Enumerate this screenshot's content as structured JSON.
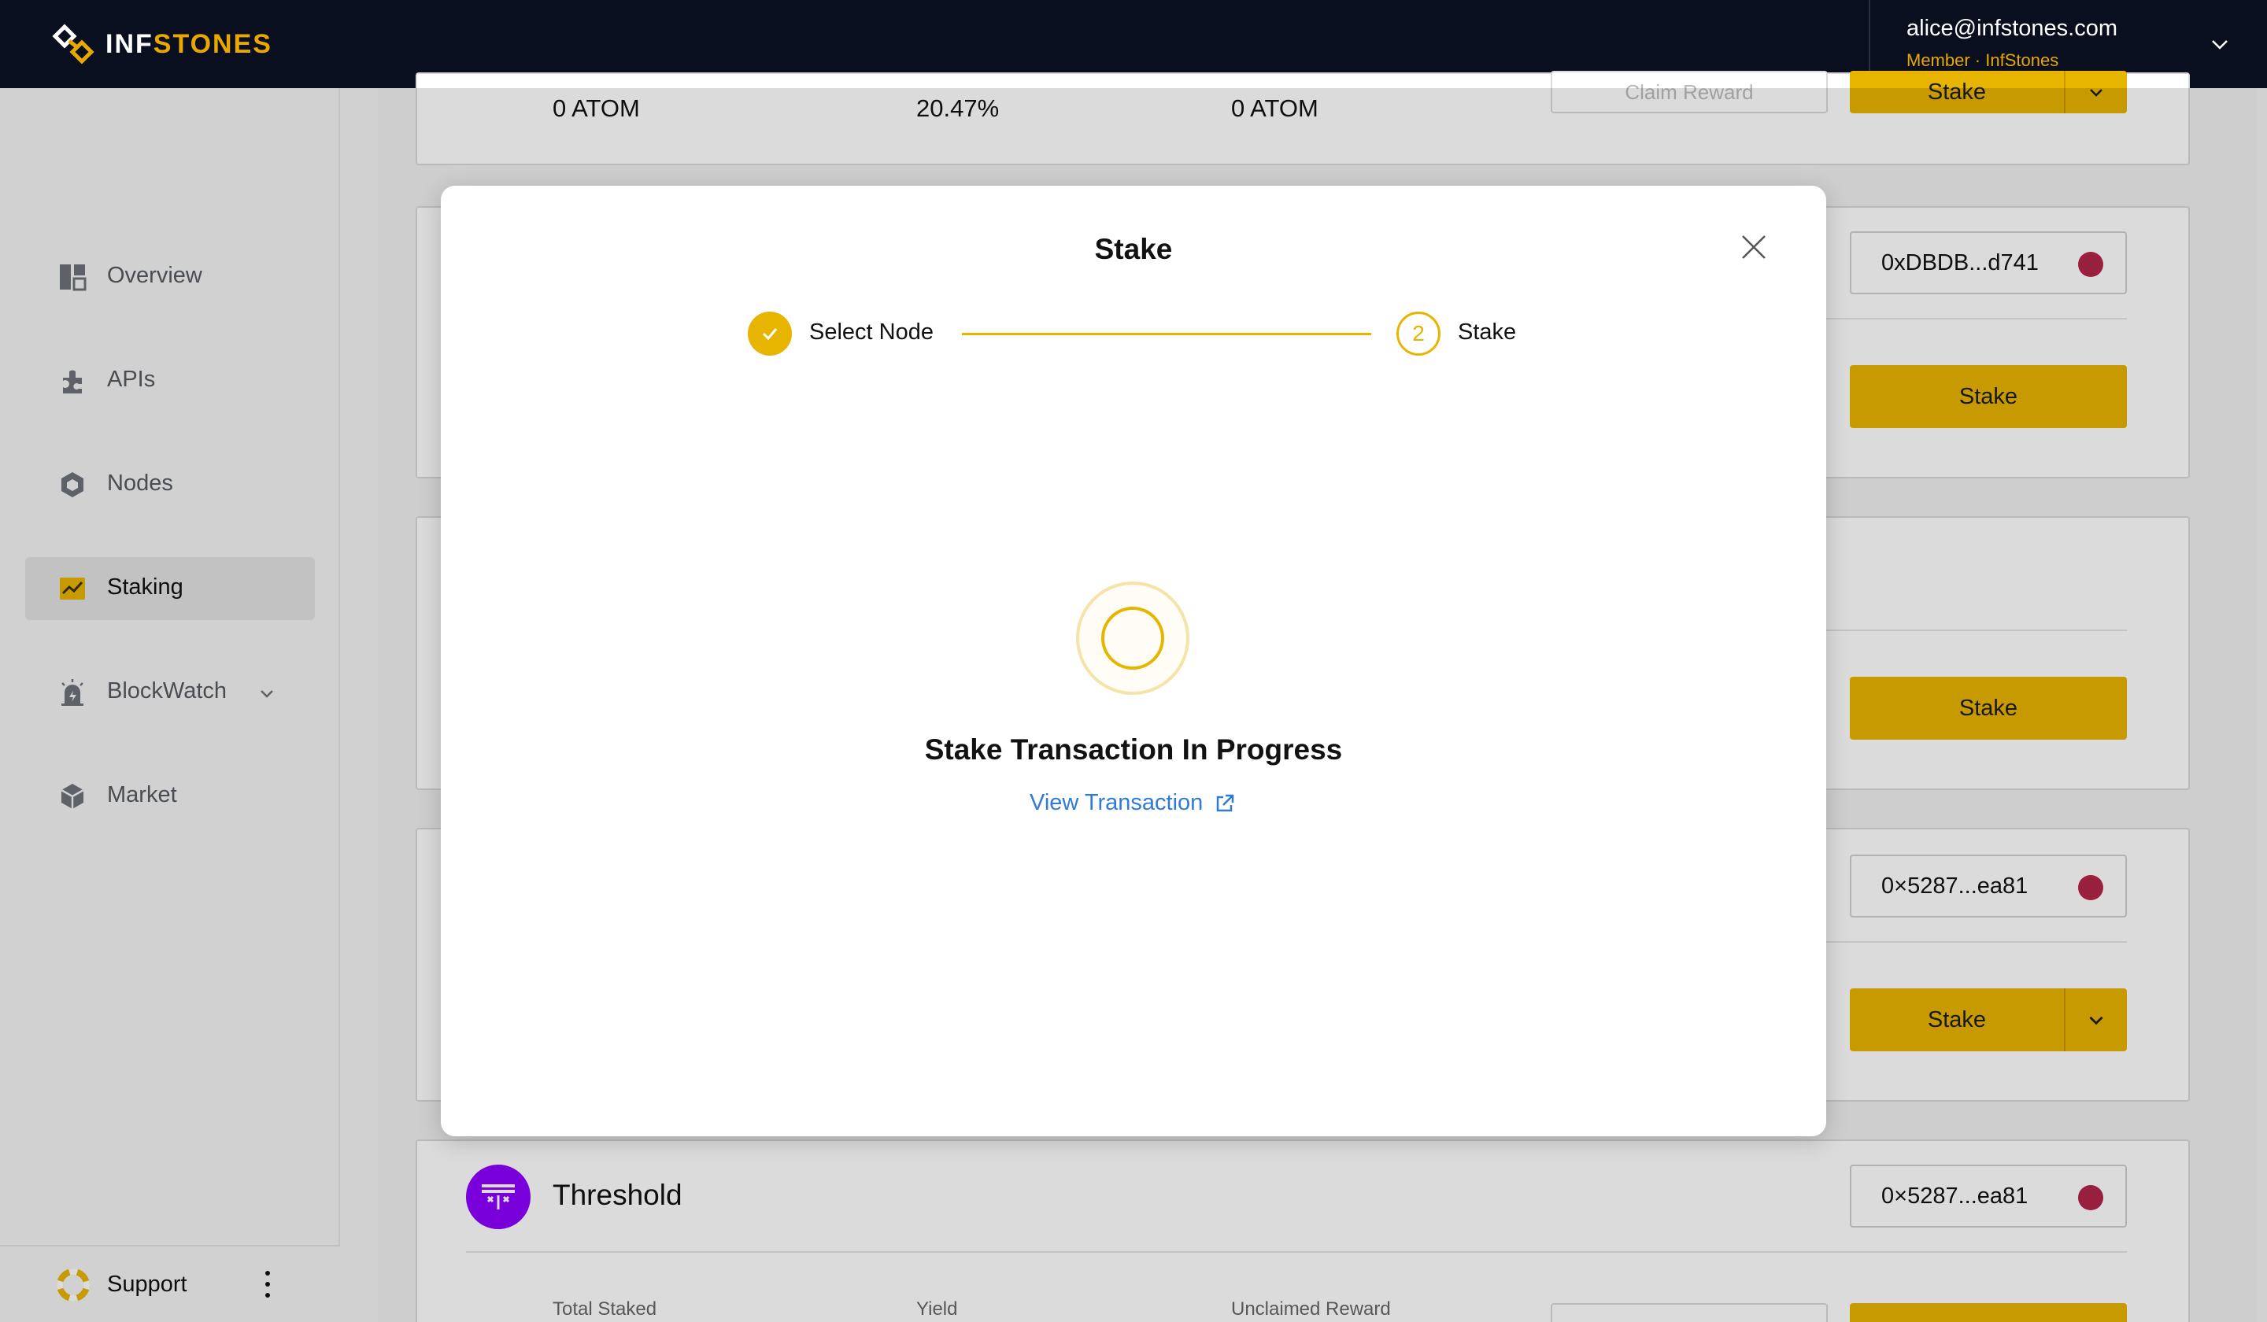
{
  "brand": {
    "name_white": "INF",
    "name_yellow": "STONES"
  },
  "account": {
    "email": "alice@infstones.com",
    "role": "Member · InfStones"
  },
  "sidebar": {
    "items": [
      {
        "label": "Overview",
        "icon": "overview-icon"
      },
      {
        "label": "APIs",
        "icon": "apis-icon"
      },
      {
        "label": "Nodes",
        "icon": "nodes-icon"
      },
      {
        "label": "Staking",
        "icon": "staking-icon",
        "active": true
      },
      {
        "label": "BlockWatch",
        "icon": "blockwatch-icon",
        "has_submenu": true
      },
      {
        "label": "Market",
        "icon": "market-icon"
      }
    ],
    "support_label": "Support"
  },
  "cards": {
    "top": {
      "total_staked": "0 ATOM",
      "yield": "20.47%",
      "unclaimed": "0 ATOM",
      "claim_label": "Claim Reward",
      "stake_label": "Stake"
    },
    "card2": {
      "address": "0xDBDB...d741",
      "stake_label": "Stake"
    },
    "card3": {
      "stake_label": "Stake"
    },
    "card4": {
      "address": "0×5287...ea81",
      "stake_label": "Stake"
    },
    "threshold": {
      "name": "Threshold",
      "address": "0×5287...ea81",
      "total_staked_label": "Total Staked",
      "yield_label": "Yield",
      "unclaimed_label": "Unclaimed Reward"
    }
  },
  "modal": {
    "title": "Stake",
    "steps": [
      {
        "label": "Select Node",
        "state": "done"
      },
      {
        "number": "2",
        "label": "Stake",
        "state": "current"
      }
    ],
    "status_title": "Stake Transaction In Progress",
    "link_label": "View Transaction"
  },
  "colors": {
    "accent": "#e7b400",
    "topbar": "#0a0f1f",
    "link": "#2f7bd6",
    "address_dot": "#b3254a",
    "threshold": "#8f00ff"
  }
}
